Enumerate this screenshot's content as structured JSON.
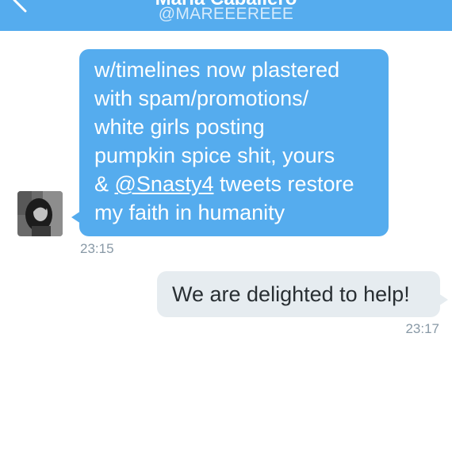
{
  "header": {
    "name": "María Caballero",
    "handle": "@MAREEEREEE"
  },
  "colors": {
    "accent": "#55acee",
    "outgoing_bubble": "#e6ecf0",
    "timestamp": "#8899a6"
  },
  "messages": [
    {
      "direction": "incoming",
      "lines": [
        "w/timelines now plastered",
        "with spam/promotions/",
        "white girls posting",
        "pumpkin spice shit, yours"
      ],
      "mention_prefix": "& ",
      "mention": "@Snasty4",
      "mention_suffix": " tweets restore",
      "last_line": "my faith in humanity",
      "time": "23:15"
    },
    {
      "direction": "outgoing",
      "text": "We are delighted to help!",
      "time": "23:17"
    }
  ]
}
